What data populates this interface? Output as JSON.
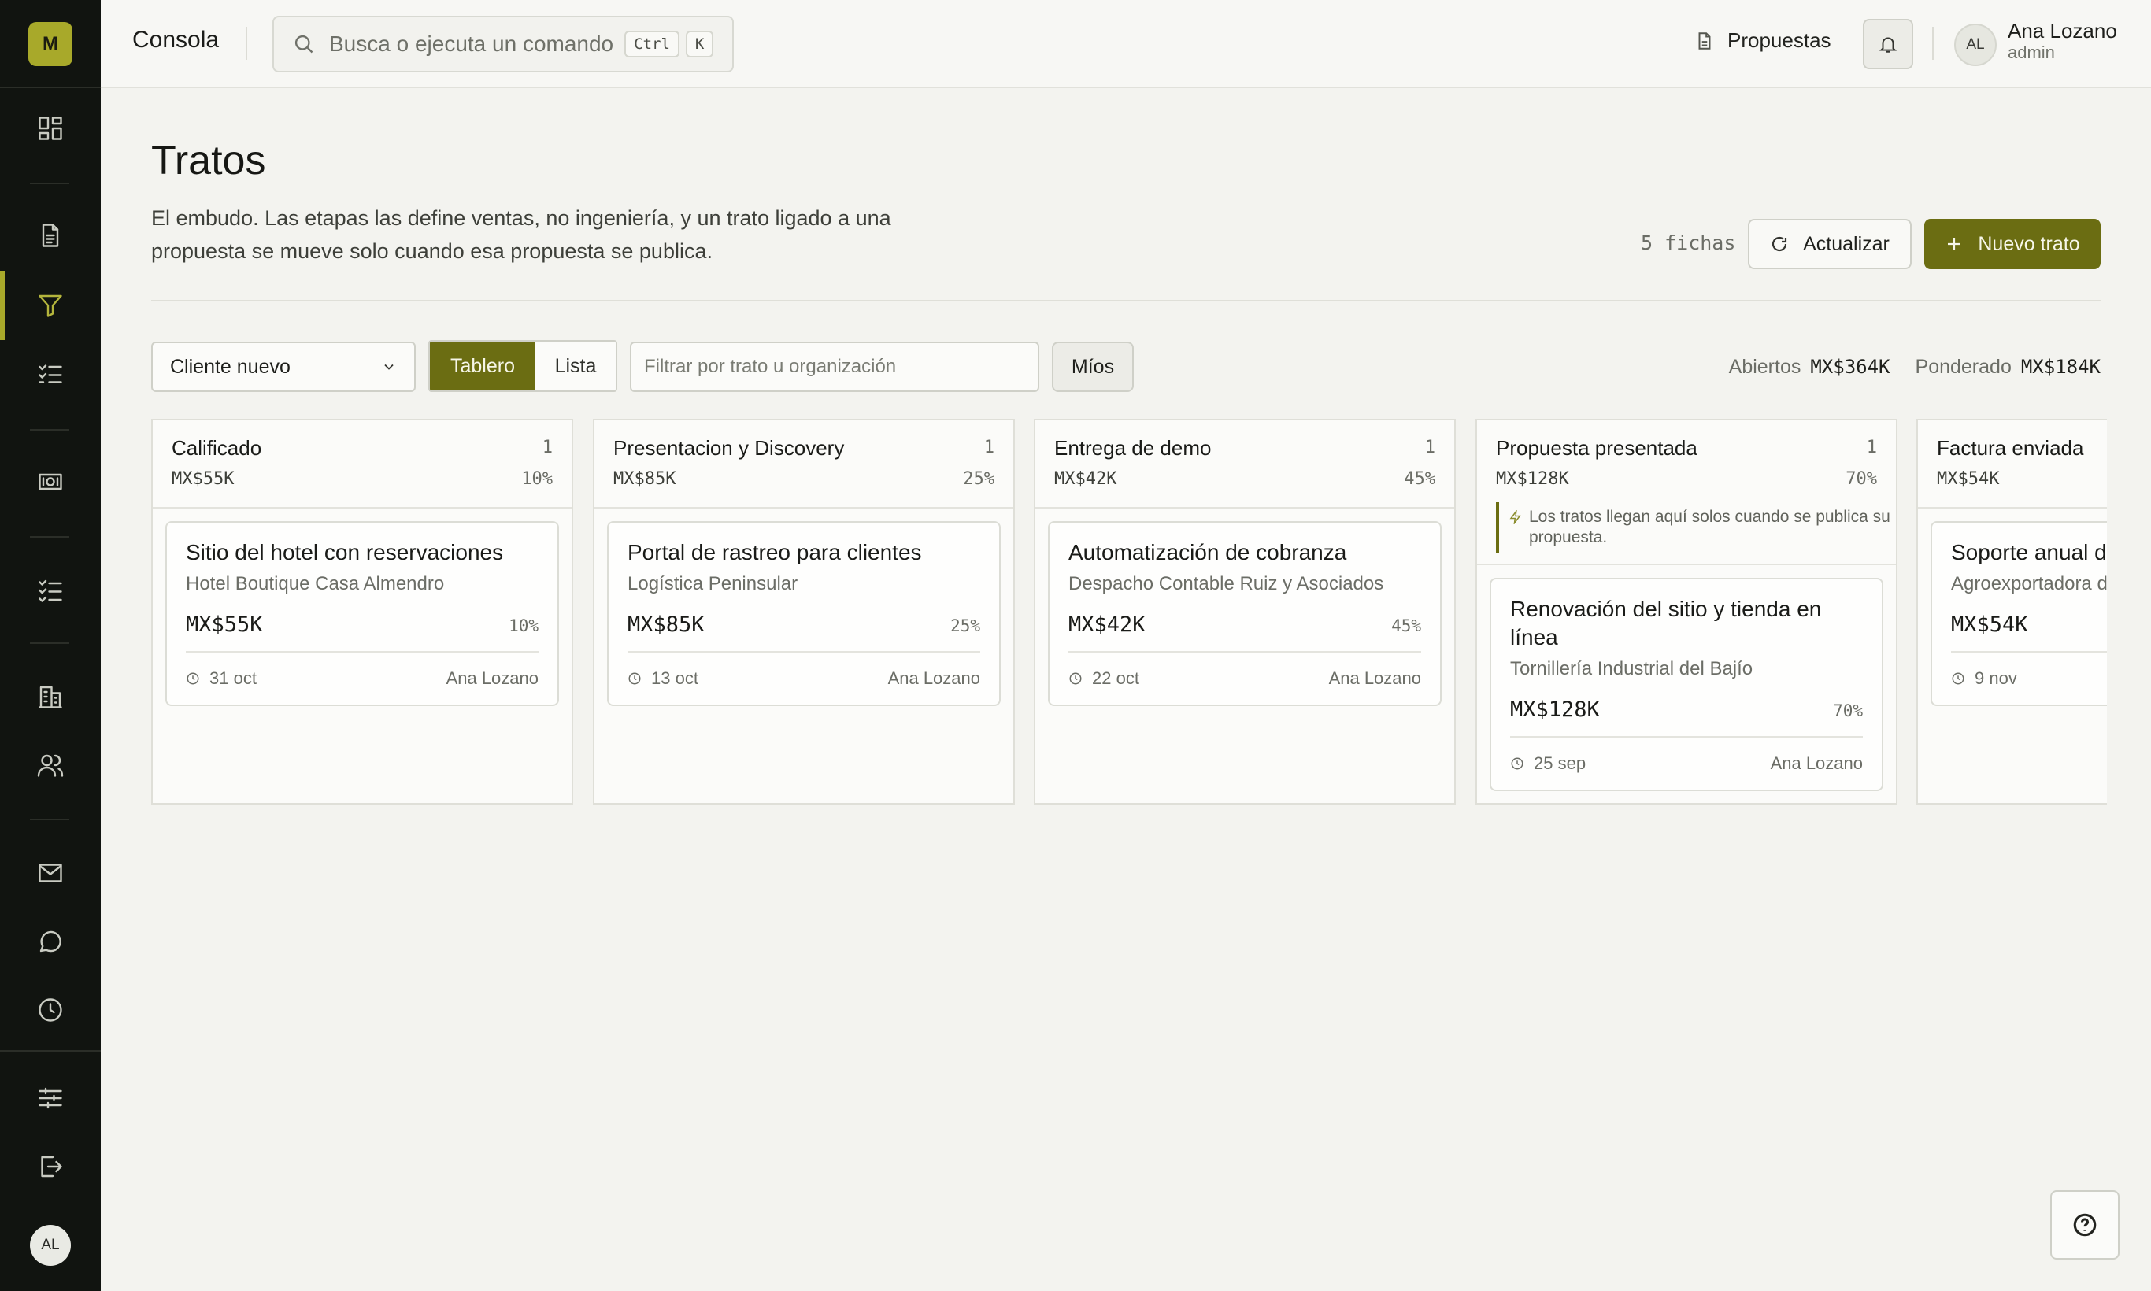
{
  "sidebar": {
    "logo_letter": "M",
    "user_initials": "AL",
    "items": [
      {
        "icon": "dashboard-icon"
      },
      {
        "icon": "document-icon"
      },
      {
        "icon": "funnel-icon",
        "active": true
      },
      {
        "icon": "checklist-icon"
      },
      {
        "icon": "cash-icon"
      },
      {
        "icon": "tasks-icon"
      },
      {
        "icon": "building-icon"
      },
      {
        "icon": "users-icon"
      },
      {
        "icon": "mail-icon"
      },
      {
        "icon": "chat-icon"
      },
      {
        "icon": "clock-icon"
      },
      {
        "icon": "sliders-icon"
      },
      {
        "icon": "logout-icon"
      }
    ]
  },
  "topbar": {
    "brand": "Consola",
    "search_placeholder": "Busca o ejecuta un comando",
    "shortcut_keys": [
      "Ctrl",
      "K"
    ],
    "proposals_link": "Propuestas",
    "user": {
      "initials": "AL",
      "name": "Ana Lozano",
      "role": "admin"
    }
  },
  "header": {
    "title": "Tratos",
    "description": "El embudo. Las etapas las define ventas, no ingeniería, y un trato ligado a una propuesta se mueve solo cuando esa propuesta se publica.",
    "count_label": "5 fichas",
    "refresh_label": "Actualizar",
    "new_label": "Nuevo trato"
  },
  "filters": {
    "select_value": "Cliente nuevo",
    "view_tabs": [
      "Tablero",
      "Lista"
    ],
    "active_view": "Tablero",
    "filter_placeholder": "Filtrar por trato u organización",
    "mine_label": "Míos",
    "open_label": "Abiertos",
    "open_value": "MX$364K",
    "weighted_label": "Ponderado",
    "weighted_value": "MX$184K"
  },
  "columns": [
    {
      "name": "Calificado",
      "count": "1",
      "amount": "MX$55K",
      "pct": "10%",
      "cards": [
        {
          "title": "Sitio del hotel con reservaciones",
          "org": "Hotel Boutique Casa Almendro",
          "amount": "MX$55K",
          "pct": "10%",
          "date": "31 oct",
          "owner": "Ana Lozano"
        }
      ]
    },
    {
      "name": "Presentacion y Discovery",
      "count": "1",
      "amount": "MX$85K",
      "pct": "25%",
      "cards": [
        {
          "title": "Portal de rastreo para clientes",
          "org": "Logística Peninsular",
          "amount": "MX$85K",
          "pct": "25%",
          "date": "13 oct",
          "owner": "Ana Lozano"
        }
      ]
    },
    {
      "name": "Entrega de demo",
      "count": "1",
      "amount": "MX$42K",
      "pct": "45%",
      "cards": [
        {
          "title": "Automatización de cobranza",
          "org": "Despacho Contable Ruiz y Asociados",
          "amount": "MX$42K",
          "pct": "45%",
          "date": "22 oct",
          "owner": "Ana Lozano"
        }
      ]
    },
    {
      "name": "Propuesta presentada",
      "count": "1",
      "amount": "MX$128K",
      "pct": "70%",
      "note": "Los tratos llegan aquí solos cuando se publica su propuesta.",
      "cards": [
        {
          "title": "Renovación del sitio y tienda en línea",
          "org": "Tornillería Industrial del Bajío",
          "amount": "MX$128K",
          "pct": "70%",
          "date": "25 sep",
          "owner": "Ana Lozano"
        }
      ]
    },
    {
      "name": "Factura enviada",
      "count": "",
      "amount": "MX$54K",
      "pct": "",
      "cards": [
        {
          "title": "Soporte anual d",
          "org": "Agroexportadora d",
          "amount": "MX$54K",
          "pct": "",
          "date": "9 nov",
          "owner": ""
        }
      ]
    }
  ]
}
